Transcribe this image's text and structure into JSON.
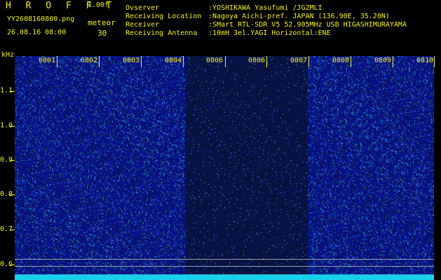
{
  "header": {
    "app_title": "H R O F F T",
    "app_version": "1.00f",
    "filename": "YY2608160800.png",
    "datetime": "26.08.16 08:00",
    "meteor_label": "meteor",
    "meteor_count": "30"
  },
  "info": [
    {
      "label": "Ovserver",
      "value": ":YOSHIKAWA Yasufumi /JG2MLI"
    },
    {
      "label": "Receiving Location",
      "value": ":Nagoya Aichi-pref. JAPAN (136.90E, 35.20N)"
    },
    {
      "label": "Receiver",
      "value": ":SMart RTL-SDR V5 52.905MHz USB HIGASHIMURAYAMA"
    },
    {
      "label": "Receiving Antenna",
      "value": ":10mH 3el.YAGI Horizontal:ENE"
    }
  ],
  "axis": {
    "y_unit": "kHz",
    "y_ticks": [
      "1.1",
      "1.0",
      "0.9",
      "0.8",
      "0.7",
      "0.6"
    ],
    "x_ticks": [
      "0801",
      "0802",
      "0803",
      "0804",
      "0806",
      "0806",
      "0807",
      "0808",
      "0809",
      "0810"
    ]
  },
  "colors": {
    "label": "#f2f21c",
    "background": "#000000",
    "baseline": "#19d0ea"
  }
}
